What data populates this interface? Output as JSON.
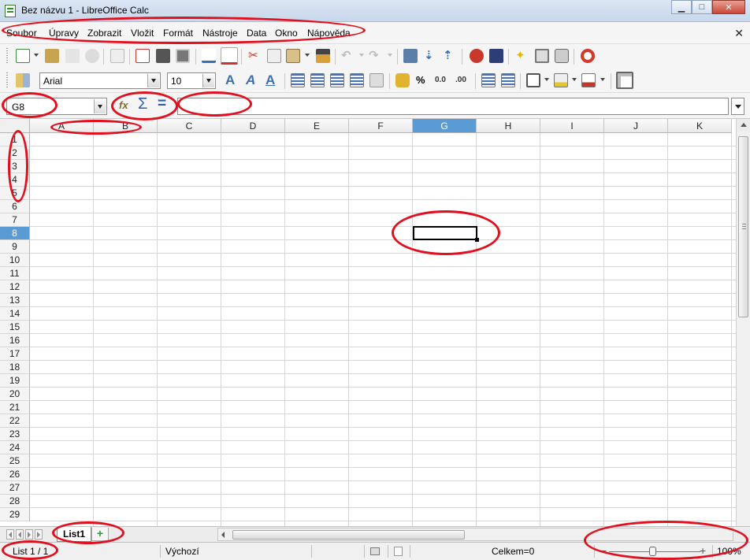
{
  "window": {
    "title": "Bez názvu 1 - LibreOffice Calc"
  },
  "menu": [
    "Soubor",
    "Úpravy",
    "Zobrazit",
    "Vložit",
    "Formát",
    "Nástroje",
    "Data",
    "Okno",
    "Nápověda"
  ],
  "toolbar": {
    "font_name": "Arial",
    "font_size": "10"
  },
  "formula_bar": {
    "name_box": "G8",
    "fx_label": "fx",
    "sum_label": "Σ",
    "equals_label": "=",
    "formula": ""
  },
  "sheet": {
    "columns": [
      "A",
      "B",
      "C",
      "D",
      "E",
      "F",
      "G",
      "H",
      "I",
      "J",
      "K"
    ],
    "rows": [
      "1",
      "2",
      "3",
      "4",
      "5",
      "6",
      "7",
      "8",
      "9",
      "10",
      "11",
      "12",
      "13",
      "14",
      "15",
      "16",
      "17",
      "18",
      "19",
      "20",
      "21",
      "22",
      "23",
      "24",
      "25",
      "26",
      "27",
      "28",
      "29"
    ],
    "active_column": "G",
    "active_row": "8",
    "active_cell": "G8"
  },
  "sheet_tabs": [
    {
      "label": "List1"
    }
  ],
  "status": {
    "sheet_position": "List 1 / 1",
    "page_style": "Výchozí",
    "sum": "Celkem=0",
    "zoom": "100%"
  },
  "annotation_color": "#e0101e"
}
